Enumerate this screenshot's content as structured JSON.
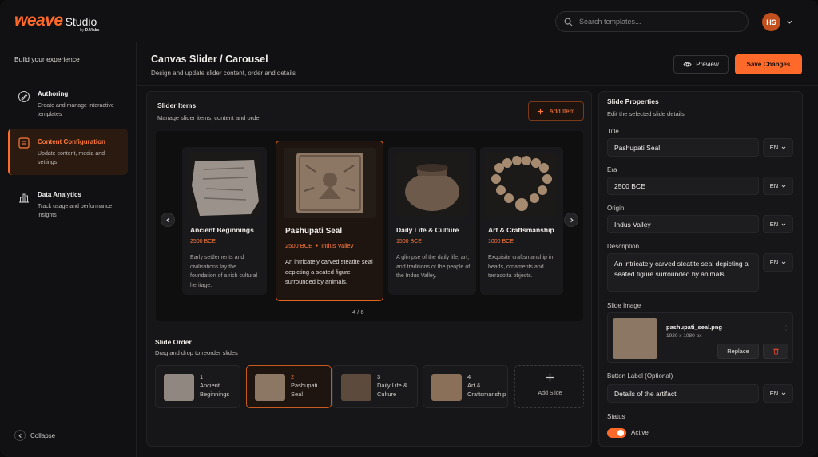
{
  "brand": {
    "logo": "weave",
    "suffix": "Studio",
    "by_prefix": "by",
    "by_name": "DJ/labs"
  },
  "search": {
    "placeholder": "Search templates..."
  },
  "user": {
    "initials": "HS"
  },
  "sidebar": {
    "title": "Build your experience",
    "items": [
      {
        "label": "Authoring",
        "desc": "Create and manage interactive templates",
        "icon": "pen-icon",
        "active": false
      },
      {
        "label": "Content Configuration",
        "desc": "Update content, media and settings",
        "icon": "content-icon",
        "active": true
      },
      {
        "label": "Data Analytics",
        "desc": "Track usage and performance insights",
        "icon": "chart-icon",
        "active": false
      }
    ],
    "collapse": "Collapse"
  },
  "header": {
    "title": "Canvas Slider / Carousel",
    "subtitle": "Design and update slider content, order and details",
    "preview": "Preview",
    "save": "Save Changes"
  },
  "slider": {
    "title": "Slider Items",
    "subtitle": "Manage slider items, content and order",
    "add_item": "Add Item",
    "pager": "4 / 6",
    "cards": [
      {
        "title": "Ancient Beginnings",
        "era": "2500 BCE",
        "origin": "",
        "desc": "Early settlements and civilisations lay the foundation of a rich cultural heritage."
      },
      {
        "title": "Pashupati Seal",
        "era": "2500 BCE",
        "origin": "Indus Valley",
        "desc": "An intricately carved steatite seal depicting a seated figure surrounded by animals."
      },
      {
        "title": "Daily Life & Culture",
        "era": "1500 BCE",
        "origin": "",
        "desc": "A glimpse of the daily life, art, and traditions of the people of the Indus Valley."
      },
      {
        "title": "Art & Craftsmanship",
        "era": "1000 BCE",
        "origin": "",
        "desc": "Exquisite craftsmanship in beads, ornaments and terracotta objects."
      }
    ]
  },
  "order": {
    "title": "Slide Order",
    "subtitle": "Drag and drop to reorder slides",
    "items": [
      {
        "num": "1",
        "name": "Ancient Beginnings"
      },
      {
        "num": "2",
        "name": "Pashupati Seal"
      },
      {
        "num": "3",
        "name": "Daily Life & Culture"
      },
      {
        "num": "4",
        "name": "Art & Craftsmanship"
      }
    ],
    "add": "Add Slide"
  },
  "props": {
    "title": "Slide Properties",
    "subtitle": "Edit the selected slide details",
    "title_label": "Title",
    "title_value": "Pashupati Seal",
    "era_label": "Era",
    "era_value": "2500 BCE",
    "origin_label": "Origin",
    "origin_value": "Indus Valley",
    "desc_label": "Description",
    "desc_value": "An intricately carved steatite seal depicting a seated figure surrounded by animals.",
    "lang": "EN",
    "image_label": "Slide Image",
    "image_name": "pashupati_seal.png",
    "image_size": "1920 x 1080 px",
    "replace": "Replace",
    "button_label": "Button Label (Optional)",
    "button_value": "Details of the artifact",
    "status_label": "Status",
    "status_value": "Active"
  },
  "colors": {
    "accent": "#ff6a2b",
    "bg": "#111113",
    "panel": "#161618"
  }
}
